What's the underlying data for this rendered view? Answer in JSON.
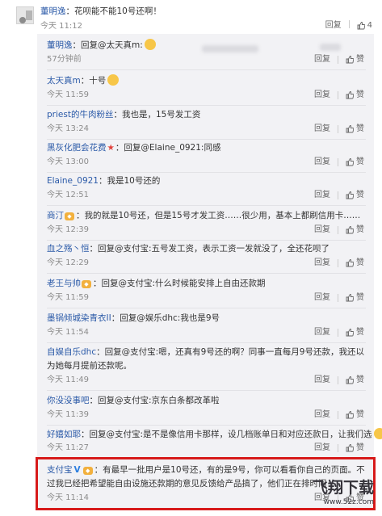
{
  "top_comment": {
    "author": "董明逸",
    "text": "：花呗能不能10号还啊！",
    "time": "今天 11:12",
    "reply_label": "回复",
    "like_count": "4"
  },
  "replies": [
    {
      "author": "董明逸",
      "text": "：回复@太天真m:",
      "emoji": "laugh-emoji",
      "time": "57分钟前",
      "reply_label": "回复",
      "like_label": "赞"
    },
    {
      "author": "太天真m",
      "text": "：十号",
      "emoji": "smile-emoji",
      "time": "今天 11:59",
      "reply_label": "回复",
      "like_label": "赞"
    },
    {
      "author": "priest的牛肉粉丝",
      "text": "：我也是，15号发工资",
      "time": "今天 13:24",
      "reply_label": "回复",
      "like_label": "赞"
    },
    {
      "author": "黑灰化肥会花费",
      "text": "：回复@Elaine_0921:同感",
      "time": "今天 13:00",
      "reply_label": "回复",
      "like_label": "赞"
    },
    {
      "author": "Elaine_0921",
      "text": "：我是10号还的",
      "time": "今天 12:51",
      "reply_label": "回复",
      "like_label": "赞"
    },
    {
      "author": "商汀",
      "text": "：我的就是10号还，但是15号才发工资……很少用，基本上都刷信用卡……",
      "time": "今天 12:39",
      "reply_label": "回复",
      "like_label": "赞"
    },
    {
      "author": "血之殇丶恒",
      "text": "：回复@支付宝:五号发工资，表示工资一发就没了，全还花呗了",
      "time": "今天 12:29",
      "reply_label": "回复",
      "like_label": "赞"
    },
    {
      "author": "老王与帅",
      "text": "：回复@支付宝:什么时候能安排上自由还款期",
      "time": "今天 11:59",
      "reply_label": "回复",
      "like_label": "赞"
    },
    {
      "author": "墨锅倾城染青衣II",
      "text": "：回复@娱乐dhc:我也是9号",
      "time": "今天 11:54",
      "reply_label": "回复",
      "like_label": "赞"
    },
    {
      "author": "自娱自乐dhc",
      "text": "：回复@支付宝:嗯，还真有9号还的啊？同事一直每月9号还款，我还以为她每月提前还款呢。",
      "time": "今天 11:49",
      "reply_label": "回复",
      "like_label": "赞"
    },
    {
      "author": "你没没事吧",
      "text": "：回复@支付宝:京东白条都改革啦",
      "time": "今天 11:39",
      "reply_label": "回复",
      "like_label": "赞"
    },
    {
      "author": "好嬉如耶",
      "text": "：回复@支付宝:是不是像信用卡那样，设几档账单日和对应还款日，让我们选",
      "emoji": "laugh-emoji",
      "time": "今天 11:27",
      "reply_label": "回复",
      "like_label": "赞"
    },
    {
      "author": "支付宝",
      "text": "：有最早一批用户是10号还，有的是9号，你可以看看你自己的页面。不过我已经把希望能自由设施还款期的意见反馈给产品搞了，他们正在排时间",
      "time": "今天 11:14",
      "reply_label": "回复",
      "like_label": "赞"
    }
  ],
  "watermark": {
    "title": "飞翔下载",
    "url": "www.52z.com"
  },
  "colors": {
    "name": "#2b5aa8",
    "highlight": "#d71a1a",
    "reply_bg": "#f2f2f5"
  }
}
